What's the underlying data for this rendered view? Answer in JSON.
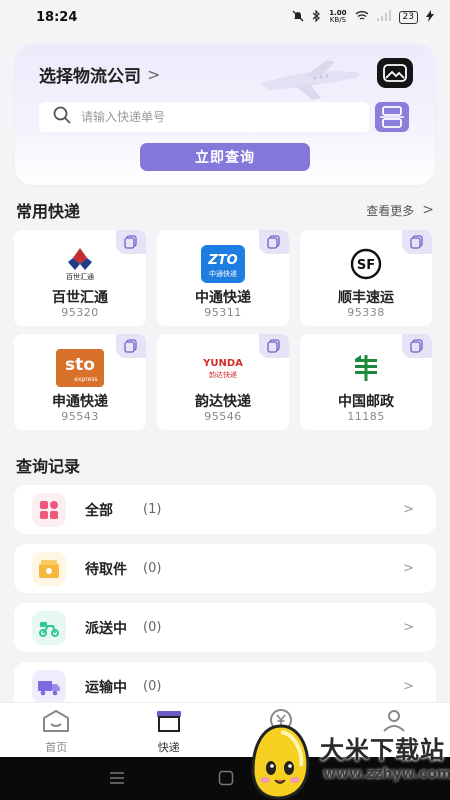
{
  "status_bar": {
    "time": "18:24",
    "net_speed_value": "1.00",
    "net_speed_unit": "KB/S",
    "battery": "23"
  },
  "search": {
    "title": "选择物流公司",
    "placeholder": "请输入快递单号",
    "query_button": "立即查询"
  },
  "common": {
    "title": "常用快递",
    "more": "查看更多",
    "couriers": [
      {
        "name": "百世汇通",
        "phone": "95320",
        "logo": "best-express-logo",
        "logo_text": "百世汇通"
      },
      {
        "name": "中通快递",
        "phone": "95311",
        "logo": "zto-logo",
        "logo_text": "ZTO",
        "logo_sub": "中通快递"
      },
      {
        "name": "顺丰速运",
        "phone": "95338",
        "logo": "sf-logo",
        "logo_text": "SF"
      },
      {
        "name": "申通快递",
        "phone": "95543",
        "logo": "sto-logo",
        "logo_text": "sto",
        "logo_sub": "express"
      },
      {
        "name": "韵达快递",
        "phone": "95546",
        "logo": "yunda-logo",
        "logo_text": "YUNDA",
        "logo_sub": "韵达快递"
      },
      {
        "name": "中国邮政",
        "phone": "11185",
        "logo": "china-post-logo"
      }
    ]
  },
  "records": {
    "title": "查询记录",
    "items": [
      {
        "label": "全部",
        "count": "(1)",
        "icon": "grid-icon",
        "color": "#f0587b"
      },
      {
        "label": "待取件",
        "count": "(0)",
        "icon": "package-icon",
        "color": "#f6b83c"
      },
      {
        "label": "派送中",
        "count": "(0)",
        "icon": "delivery-scooter-icon",
        "color": "#2fc79a"
      },
      {
        "label": "运输中",
        "count": "(0)",
        "icon": "truck-icon",
        "color": "#7b6ae0"
      }
    ]
  },
  "tabs": [
    {
      "label": "首页",
      "icon": "home-icon"
    },
    {
      "label": "快递",
      "icon": "box-icon",
      "active": true
    },
    {
      "label": "",
      "icon": "yen-icon"
    },
    {
      "label": "",
      "icon": "user-icon"
    }
  ],
  "watermark": {
    "title": "大米下载站",
    "url": "www.zzhyw.com"
  },
  "colors": {
    "accent": "#8478da",
    "background": "#f4f4f6"
  }
}
